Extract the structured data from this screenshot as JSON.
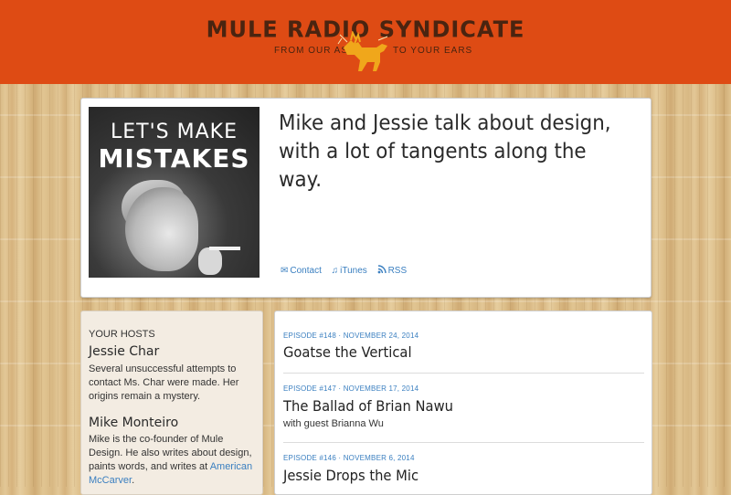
{
  "site": {
    "brand_title": "MULE RADIO SYNDICATE",
    "tagline_left": "FROM OUR ASS",
    "tagline_right": "TO YOUR EARS"
  },
  "show": {
    "cover_line1": "LET'S MAKE",
    "cover_line2": "MISTAKES",
    "description_line1": "Mike and Jessie talk about design,",
    "description_line2": "with a lot of tangents along the way.",
    "links": [
      {
        "label": "Contact",
        "icon": "envelope-icon",
        "glyph": "✉"
      },
      {
        "label": "iTunes",
        "icon": "music-note-icon",
        "glyph": "♫"
      },
      {
        "label": "RSS",
        "icon": "rss-icon",
        "glyph": "❨"
      }
    ]
  },
  "sidebar": {
    "heading": "YOUR HOSTS",
    "hosts": [
      {
        "name": "Jessie Char",
        "bio_lines": [
          "Several unsuccessful attempts to",
          "contact Ms. Char were made. Her",
          "origins remain a mystery."
        ]
      },
      {
        "name": "Mike Monteiro",
        "bio_lines": [
          "Mike is the co-founder of Mule",
          "Design. He also writes about design,",
          "paints words, and writes at"
        ],
        "link_part1": "American",
        "link_part2": "McCarver",
        "bio_end": "."
      }
    ]
  },
  "episodes": [
    {
      "meta": "EPISODE #148 · NOVEMBER 24, 2014",
      "title": "Goatse the Vertical",
      "guest": ""
    },
    {
      "meta": "EPISODE #147 · NOVEMBER 17, 2014",
      "title": "The Ballad of Brian Nawu",
      "guest": "with guest Brianna Wu"
    },
    {
      "meta": "EPISODE #146 · NOVEMBER 6, 2014",
      "title": "Jessie Drops the Mic",
      "guest": ""
    }
  ],
  "colors": {
    "header_orange": "#de4b14",
    "link_blue": "#3a7fc0",
    "brand_brown": "#4a2410",
    "mule_yellow": "#f0a71b"
  }
}
